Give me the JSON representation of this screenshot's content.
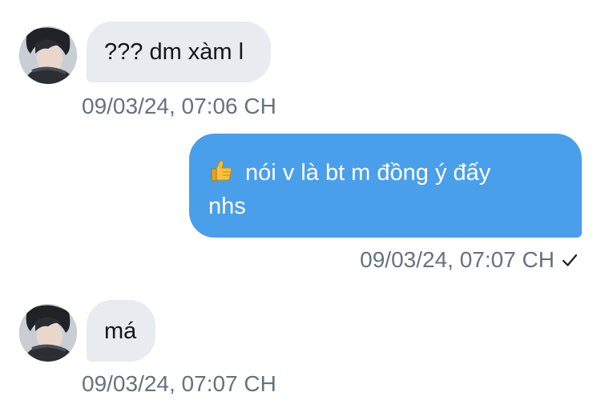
{
  "conversation": {
    "messages": [
      {
        "direction": "incoming",
        "text": "??? dm xàm l",
        "timestamp": "09/03/24, 07:06 CH"
      },
      {
        "direction": "outgoing",
        "emoji": "thumbs-up",
        "text_line1": "nói v là bt m đồng ý đấy",
        "text_line2": "nhs",
        "timestamp": "09/03/24, 07:07 CH",
        "status": "sent-check"
      },
      {
        "direction": "incoming",
        "text": "má",
        "timestamp": "09/03/24, 07:07 CH"
      }
    ]
  },
  "colors": {
    "incoming_bubble": "#e8ecf0",
    "outgoing_bubble": "#4a9fea",
    "timestamp": "#66727e",
    "text_dark": "#14171a"
  }
}
